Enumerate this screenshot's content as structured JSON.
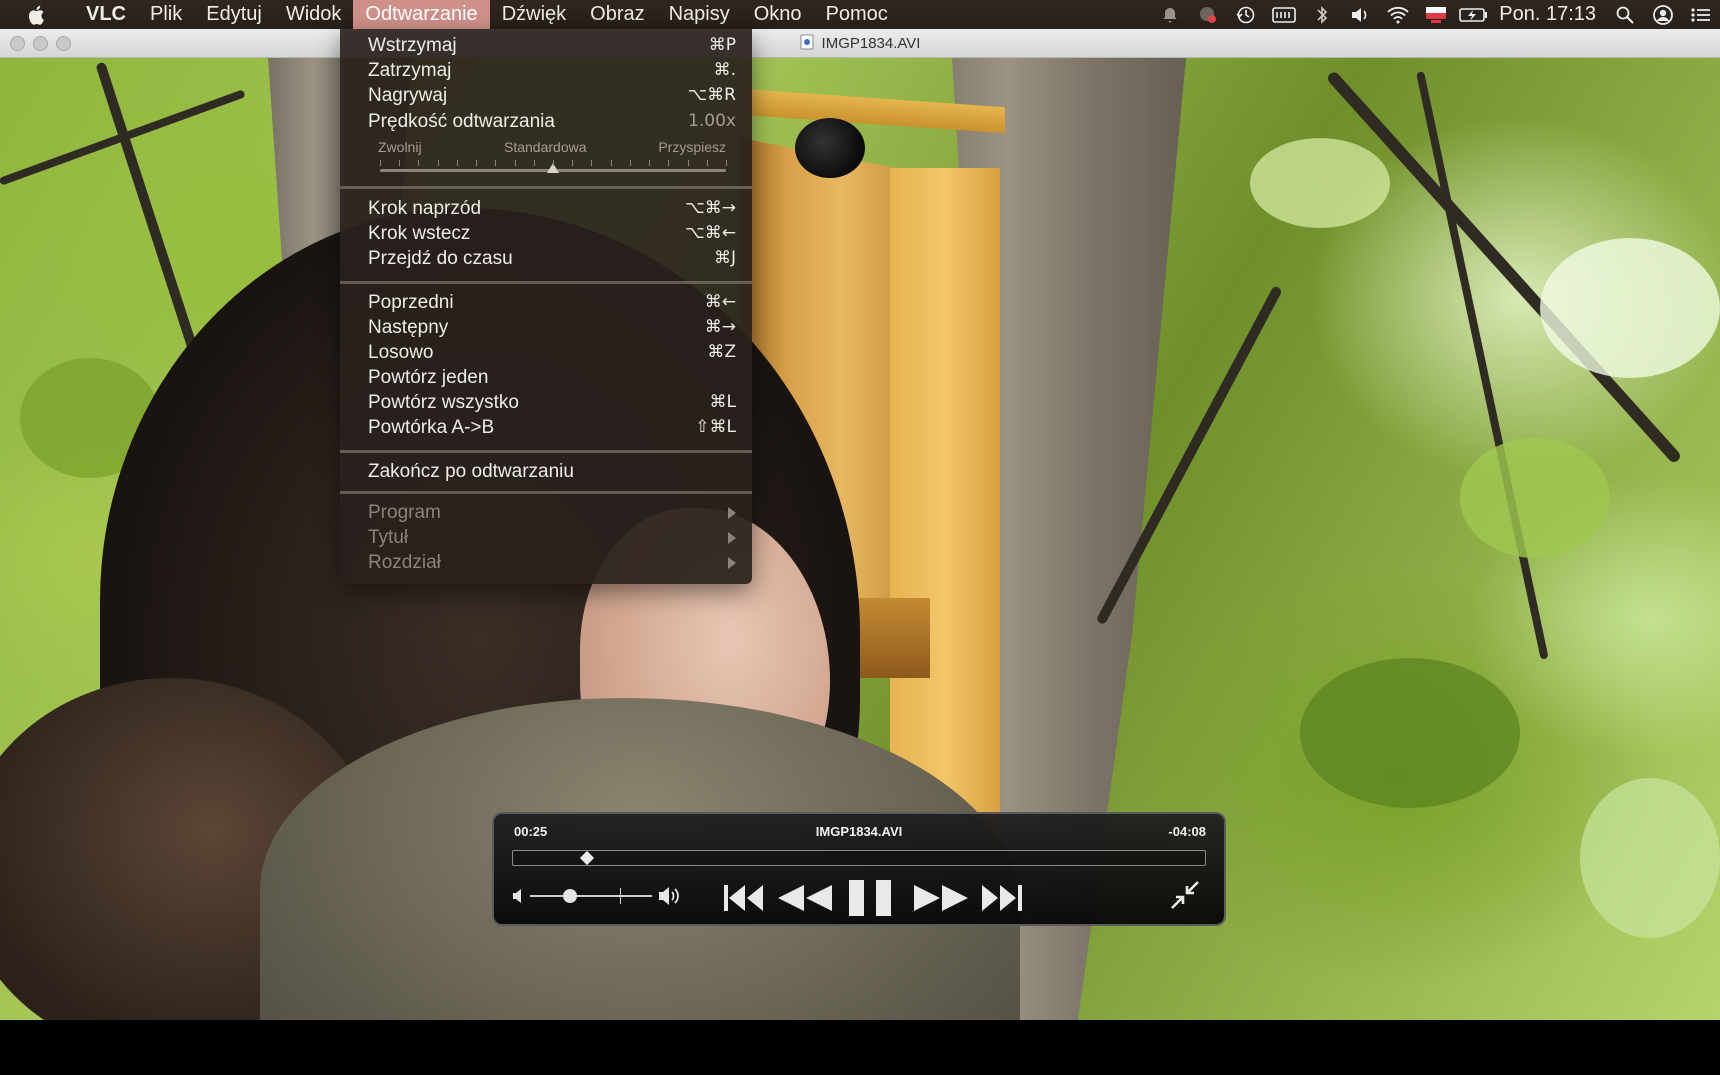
{
  "menubar": {
    "apple_icon": "apple-logo-icon",
    "app_name": "VLC",
    "menus": [
      "Plik",
      "Edytuj",
      "Widok",
      "Odtwarzanie",
      "Dźwięk",
      "Obraz",
      "Napisy",
      "Okno",
      "Pomoc"
    ],
    "active_menu": "Odtwarzanie",
    "tray_icons": [
      "notification-icon",
      "app-badge-icon",
      "time-machine-icon",
      "keyboard-icon",
      "bluetooth-icon",
      "volume-icon",
      "wifi-icon",
      "input-source-flag-icon",
      "battery-icon"
    ],
    "clock": "Pon. 17:13",
    "right_icons": [
      "spotlight-icon",
      "user-icon",
      "notification-center-icon"
    ]
  },
  "window": {
    "title": "IMGP1834.AVI",
    "file_icon": "document-icon"
  },
  "playback_menu": {
    "items_group1": [
      {
        "label": "Wstrzymaj",
        "shortcut": "⌘P"
      },
      {
        "label": "Zatrzymaj",
        "shortcut": "⌘."
      },
      {
        "label": "Nagrywaj",
        "shortcut": "⌥⌘R"
      }
    ],
    "speed": {
      "label": "Prędkość odtwarzania",
      "value": "1.00x",
      "slow_label": "Zwolnij",
      "normal_label": "Standardowa",
      "fast_label": "Przyspiesz",
      "position_fraction": 0.5
    },
    "items_group2": [
      {
        "label": "Krok naprzód",
        "shortcut": "⌥⌘→"
      },
      {
        "label": "Krok wstecz",
        "shortcut": "⌥⌘←"
      },
      {
        "label": "Przejdź do czasu",
        "shortcut": "⌘J"
      }
    ],
    "items_group3": [
      {
        "label": "Poprzedni",
        "shortcut": "⌘←"
      },
      {
        "label": "Następny",
        "shortcut": "⌘→"
      },
      {
        "label": "Losowo",
        "shortcut": "⌘Z"
      },
      {
        "label": "Powtórz jeden",
        "shortcut": ""
      },
      {
        "label": "Powtórz wszystko",
        "shortcut": "⌘L"
      },
      {
        "label": "Powtórka A->B",
        "shortcut": "⇧⌘L"
      }
    ],
    "items_group4": [
      {
        "label": "Zakończ po odtwarzaniu",
        "shortcut": ""
      }
    ],
    "items_group5": [
      {
        "label": "Program",
        "disabled": true
      },
      {
        "label": "Tytuł",
        "disabled": true
      },
      {
        "label": "Rozdział",
        "disabled": true
      }
    ]
  },
  "hud": {
    "elapsed": "00:25",
    "filename": "IMGP1834.AVI",
    "remaining": "-04:08",
    "progress_fraction": 0.107,
    "volume_fraction": 0.33,
    "icons": [
      "volume-mute-icon",
      "volume-max-icon",
      "skip-back-icon",
      "rewind-icon",
      "pause-icon",
      "fast-forward-icon",
      "skip-forward-icon",
      "exit-fullscreen-icon"
    ]
  },
  "colors": {
    "menubar_bg": "#2e241e",
    "active_menu_bg": "#d0908a",
    "dropdown_bg": "#28211c",
    "hud_bg": "#141414"
  }
}
